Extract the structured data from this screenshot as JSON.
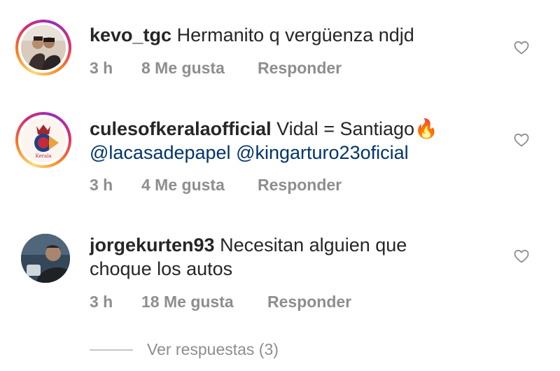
{
  "comments": [
    {
      "username": "kevo_tgc",
      "text": "Hermanito q vergüenza ndjd",
      "time": "3 h",
      "likes": "8 Me gusta",
      "reply": "Responder"
    },
    {
      "username": "culesofkeralaofficial",
      "text": "Vidal = Santiago",
      "emoji": "🔥",
      "mentions": [
        "@lacasadepapel",
        "@kingarturo23oficial"
      ],
      "avatar_text": "Kerala",
      "time": "3 h",
      "likes": "4 Me gusta",
      "reply": "Responder"
    },
    {
      "username": "jorgekurten93",
      "text_line1": "Necesitan alguien que",
      "text_line2": "choque los autos",
      "time": "3 h",
      "likes": "18 Me gusta",
      "reply": "Responder"
    }
  ],
  "view_replies": "Ver respuestas (3)",
  "icons": {
    "like": "heart-outline-icon"
  },
  "colors": {
    "text": "#262626",
    "meta": "#8e8e8e",
    "mention": "#003569",
    "story_ring": "#d62976"
  }
}
